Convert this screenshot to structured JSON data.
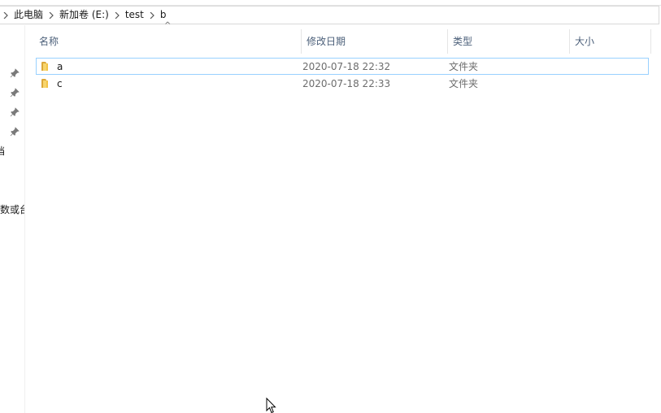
{
  "breadcrumb": {
    "items": [
      {
        "label": "此电脑"
      },
      {
        "label": "新加卷 (E:)"
      },
      {
        "label": "test"
      },
      {
        "label": "b"
      }
    ]
  },
  "nav_pane": {
    "fragments": [
      "档",
      ")",
      "数或台"
    ]
  },
  "columns": {
    "name": "名称",
    "date": "修改日期",
    "type": "类型",
    "size": "大小",
    "sort_indicator": "^"
  },
  "files": [
    {
      "name": "a",
      "modified": "2020-07-18 22:32",
      "type": "文件夹",
      "size": "",
      "focused": true
    },
    {
      "name": "c",
      "modified": "2020-07-18 22:33",
      "type": "文件夹",
      "size": "",
      "focused": false
    }
  ],
  "colors": {
    "focus_border": "#99d1ff",
    "header_text": "#4c607a",
    "folder_yellow": "#f3c347"
  },
  "icons": {
    "pin": "pin-icon",
    "folder": "folder-icon",
    "chevron": "chevron-right-icon",
    "cursor": "mouse-cursor-icon"
  }
}
